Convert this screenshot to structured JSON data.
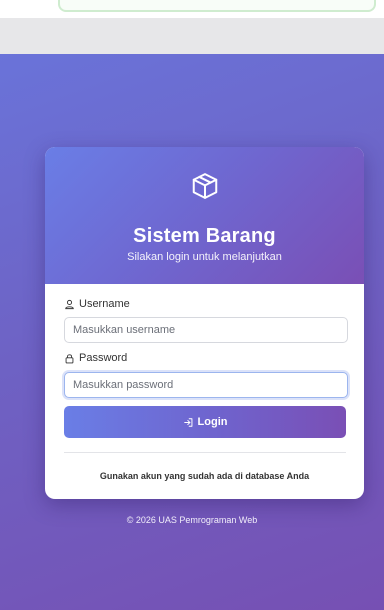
{
  "app": {
    "title": "Sistem Barang",
    "subtitle": "Silakan login untuk melanjutkan",
    "logo_icon": "box-icon"
  },
  "form": {
    "username_label": "Username",
    "username_icon": "user-icon",
    "username_placeholder": "Masukkan username",
    "username_value": "",
    "password_label": "Password",
    "password_icon": "lock-icon",
    "password_placeholder": "Masukkan password",
    "password_value": "",
    "login_label": "Login",
    "login_icon": "sign-in-icon"
  },
  "hint": "Gunakan akun yang sudah ada di database Anda",
  "footer": "© 2026 UAS Pemrograman Web",
  "colors": {
    "gradient_start": "#6a7ee6",
    "gradient_mid": "#6f66cf",
    "gradient_end": "#7a4fb5",
    "page_background": "#6e62c4",
    "card_background": "#ffffff"
  }
}
